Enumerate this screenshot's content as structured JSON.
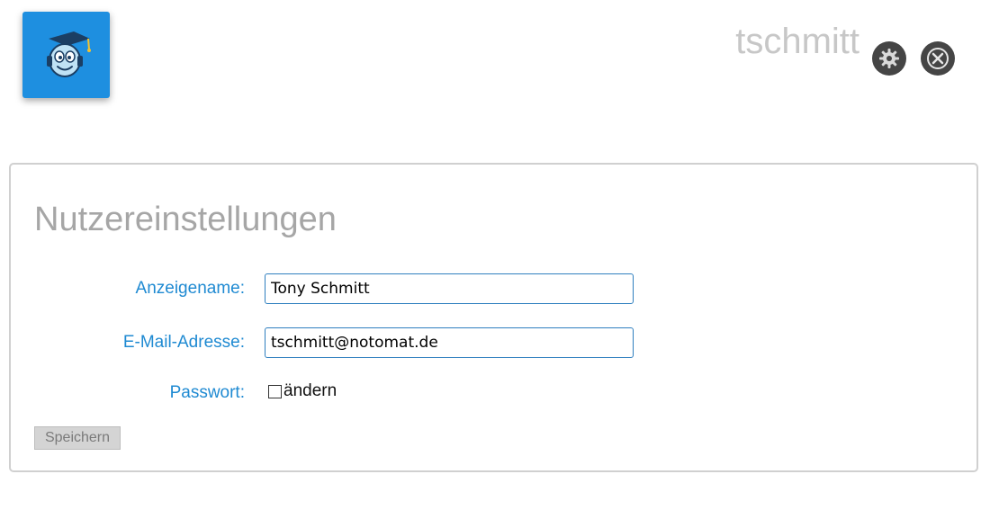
{
  "header": {
    "username": "tschmitt",
    "logo_icon": "graduate-mascot-icon",
    "settings_icon": "gear-icon",
    "logout_icon": "close-circle-icon"
  },
  "colors": {
    "logo_bg": "#1e8fe0",
    "label": "#1f8ad2",
    "title": "#a6a6a6",
    "icon_bg": "#454545"
  },
  "form": {
    "title": "Nutzereinstellungen",
    "display_name": {
      "label": "Anzeigename:",
      "value": "Tony Schmitt"
    },
    "email": {
      "label": "E-Mail-Adresse:",
      "value": "tschmitt@notomat.de"
    },
    "password": {
      "label": "Passwort:",
      "checkbox_label": "ändern"
    },
    "save_label": "Speichern"
  }
}
